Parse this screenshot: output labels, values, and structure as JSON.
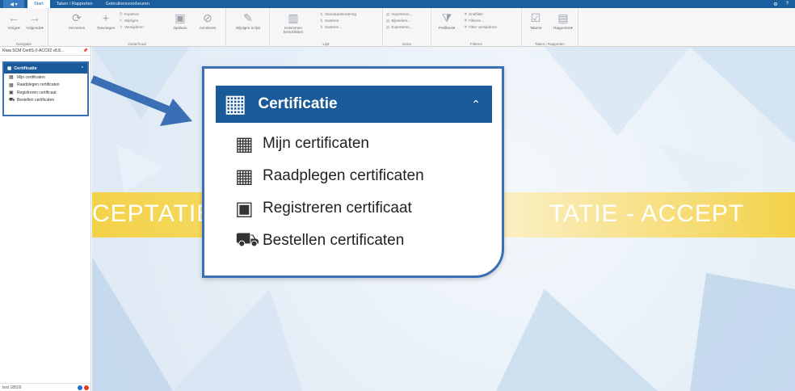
{
  "tabs": {
    "app_button": "◀ ▾",
    "items": [
      "Start",
      "Taken / Rapporten",
      "Gebruikersvoorkeuren"
    ],
    "active_index": 0
  },
  "ribbon": {
    "groups": [
      {
        "label": "Navigatie",
        "buttons": [
          "Vorige▾",
          "Volgende▾"
        ]
      },
      {
        "label": "Onderhoud",
        "buttons": [
          "Verversen",
          "Toevoegen",
          "Opslaan",
          "Annuleren"
        ],
        "small": [
          "Kopiëren",
          "Wijzigen",
          "Verwijderen"
        ]
      },
      {
        "label": "",
        "buttons": [
          "Wijzigen in lijst"
        ]
      },
      {
        "label": "Lijst",
        "buttons": [
          "Kolommen herschikken"
        ],
        "small": [
          "Standaardsortering",
          "Sorteren",
          "Sorteren..."
        ]
      },
      {
        "label": "Extra",
        "small": [
          "Importeren...",
          "Bijwerken...",
          "Exporteren..."
        ]
      },
      {
        "label": "Filteren",
        "buttons": [
          "Prefilters▾"
        ],
        "small": [
          "Snelfilter",
          "Filteren...",
          "Filter verwijderen"
        ]
      },
      {
        "label": "Taken / Rapporten",
        "buttons": [
          "Taken▾",
          "Rapporten▾"
        ]
      }
    ]
  },
  "left_panel": {
    "title": "Kiwa SCM CertIS (I-ACC02 v8.8...",
    "pin": "📌",
    "section_label": "Certificatie",
    "items": [
      "Mijn certificaten",
      "Raadplegen certificaten",
      "Registreren certificaat",
      "Bestellen certificaten"
    ],
    "status_text": "test 18529",
    "status_colors": [
      "#1e6fd0",
      "#e23b2f"
    ]
  },
  "main": {
    "banner_left": "CEPTATIE",
    "banner_right": "TATIE  -  ACCEPT"
  },
  "callout": {
    "section_label": "Certificatie",
    "items": [
      "Mijn certificaten",
      "Raadplegen certificaten",
      "Registreren certificaat",
      "Bestellen certificaten"
    ]
  },
  "colors": {
    "accent": "#1a5a99",
    "border": "#3a6fb6",
    "banner": "#f3d24a"
  }
}
